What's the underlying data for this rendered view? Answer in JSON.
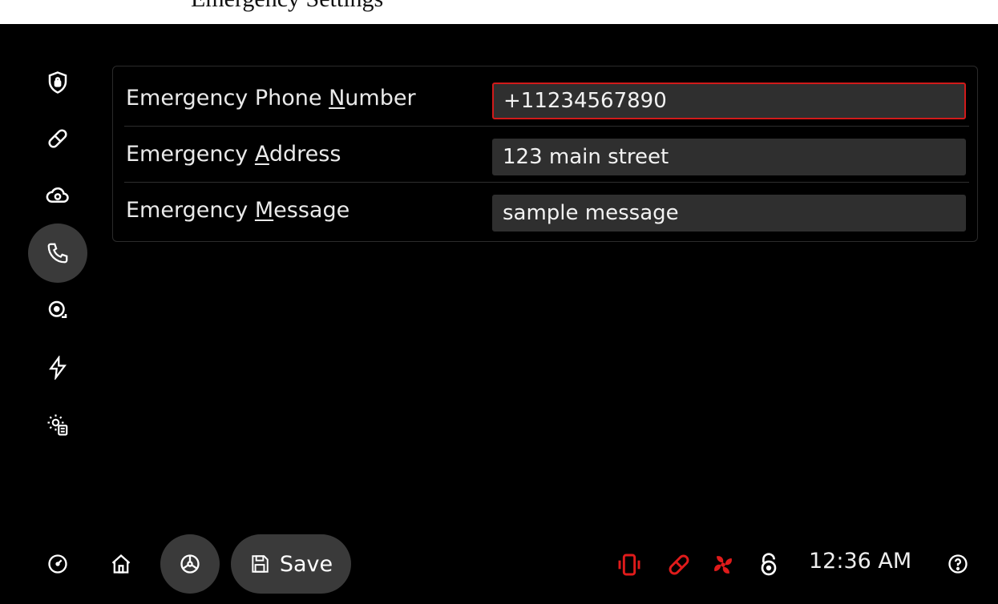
{
  "caption": {
    "text": "Emergency Settings"
  },
  "sidebar": {
    "items": [
      {
        "icon": "shield-lock-icon",
        "active": false
      },
      {
        "icon": "pill-icon",
        "active": false
      },
      {
        "icon": "cloud-sync-icon",
        "active": false
      },
      {
        "icon": "phone-icon",
        "active": true
      },
      {
        "icon": "alarm-bell-icon",
        "active": false
      },
      {
        "icon": "lightning-icon",
        "active": false
      },
      {
        "icon": "gear-document-icon",
        "active": false
      }
    ]
  },
  "form": {
    "rows": [
      {
        "label_pre": "Emergency Phone ",
        "label_key": "N",
        "label_post": "umber",
        "value": "+11234567890",
        "error": true
      },
      {
        "label_pre": "Emergency ",
        "label_key": "A",
        "label_post": "ddress",
        "value": "123 main street",
        "error": false
      },
      {
        "label_pre": "Emergency ",
        "label_key": "M",
        "label_post": "essage",
        "value": "sample message",
        "error": false
      }
    ]
  },
  "bottom_bar": {
    "save_label": "Save",
    "time": "12:36 AM",
    "status_icons": [
      "vibration-icon",
      "pill-icon",
      "fan-icon",
      "unlock-icon"
    ],
    "alert_color": "#e01b1b"
  }
}
